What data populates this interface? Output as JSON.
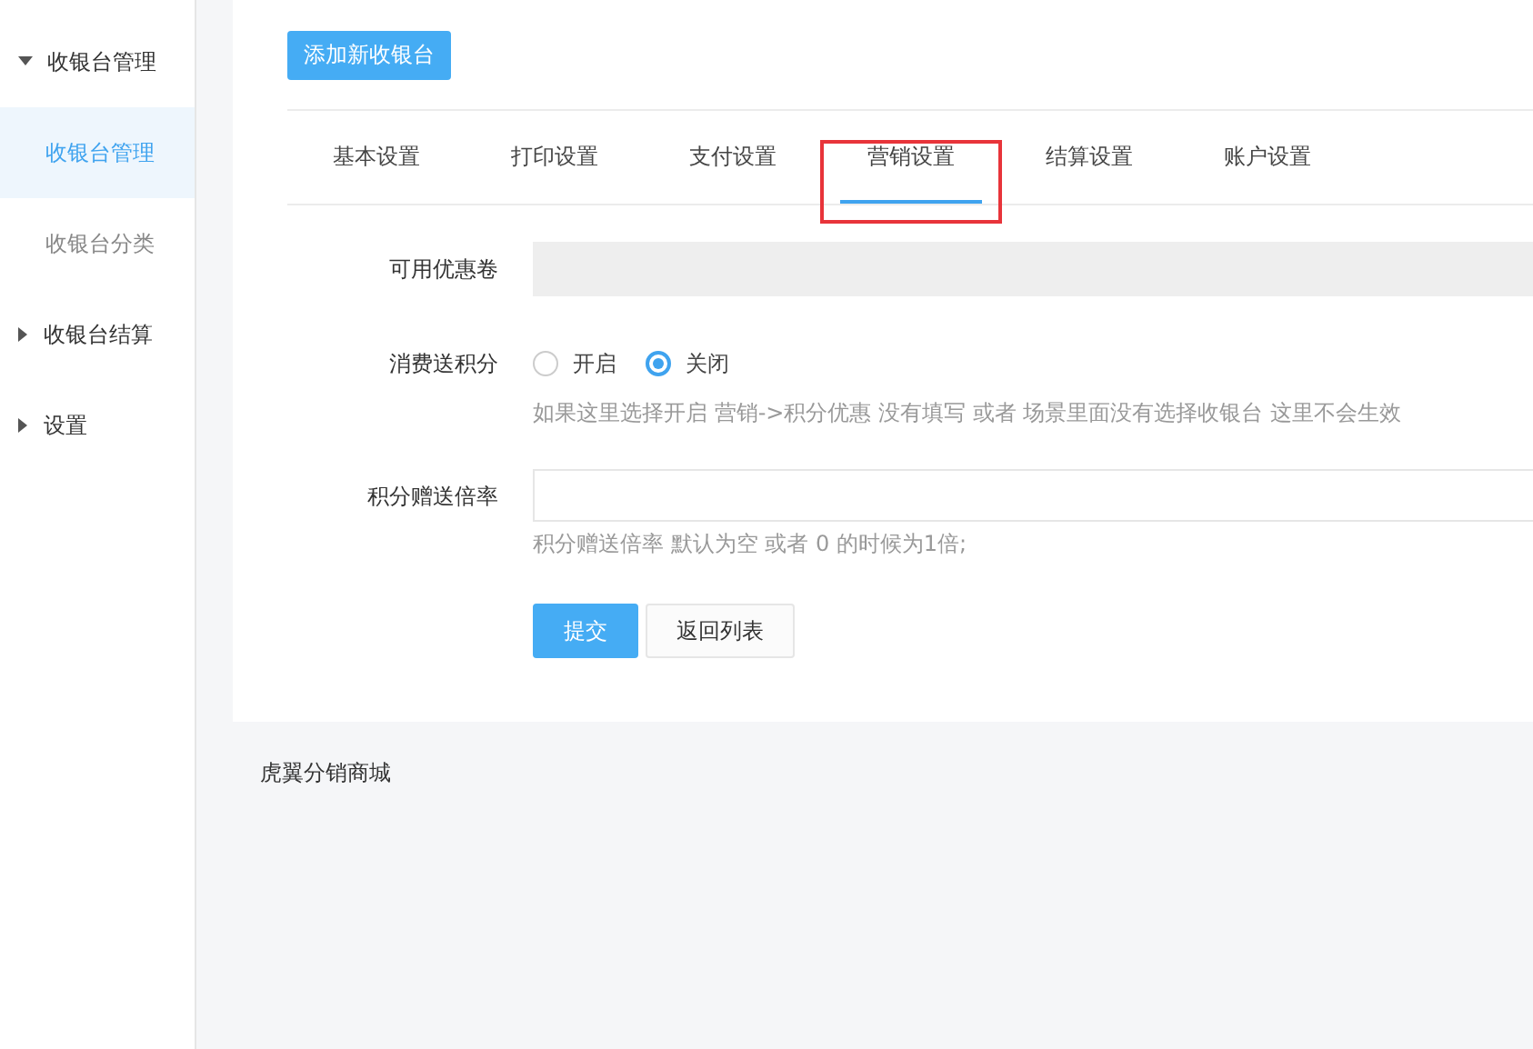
{
  "sidebar": {
    "items": [
      {
        "label": "收银台管理",
        "expanded": true,
        "children": [
          {
            "label": "收银台管理",
            "selected": true
          },
          {
            "label": "收银台分类",
            "selected": false
          }
        ]
      },
      {
        "label": "收银台结算",
        "expanded": false
      },
      {
        "label": "设置",
        "expanded": false
      }
    ]
  },
  "add_button": "添加新收银台",
  "tabs": [
    {
      "label": "基本设置",
      "selected": false,
      "highlighted": false
    },
    {
      "label": "打印设置",
      "selected": false,
      "highlighted": false
    },
    {
      "label": "支付设置",
      "selected": false,
      "highlighted": false
    },
    {
      "label": "营销设置",
      "selected": true,
      "highlighted": true
    },
    {
      "label": "结算设置",
      "selected": false,
      "highlighted": false
    },
    {
      "label": "账户设置",
      "selected": false,
      "highlighted": false
    }
  ],
  "form": {
    "fields": [
      {
        "kind": "select",
        "label": "可用优惠卷",
        "disabled": true
      },
      {
        "kind": "radio",
        "label": "消费送积分",
        "options": [
          {
            "label": "开启",
            "selected": false
          },
          {
            "label": "关闭",
            "selected": true
          }
        ],
        "hint": "如果这里选择开启 营销->积分优惠 没有填写 或者 场景里面没有选择收银台 这里不会生效"
      },
      {
        "kind": "text",
        "label": "积分赠送倍率",
        "disabled": false,
        "hint": "积分赠送倍率 默认为空 或者 0 的时候为1倍;"
      }
    ],
    "buttons": [
      {
        "label": "提交",
        "kind": "primary"
      },
      {
        "label": "返回列表",
        "kind": "default"
      }
    ]
  },
  "footer": "虎翼分销商城"
}
